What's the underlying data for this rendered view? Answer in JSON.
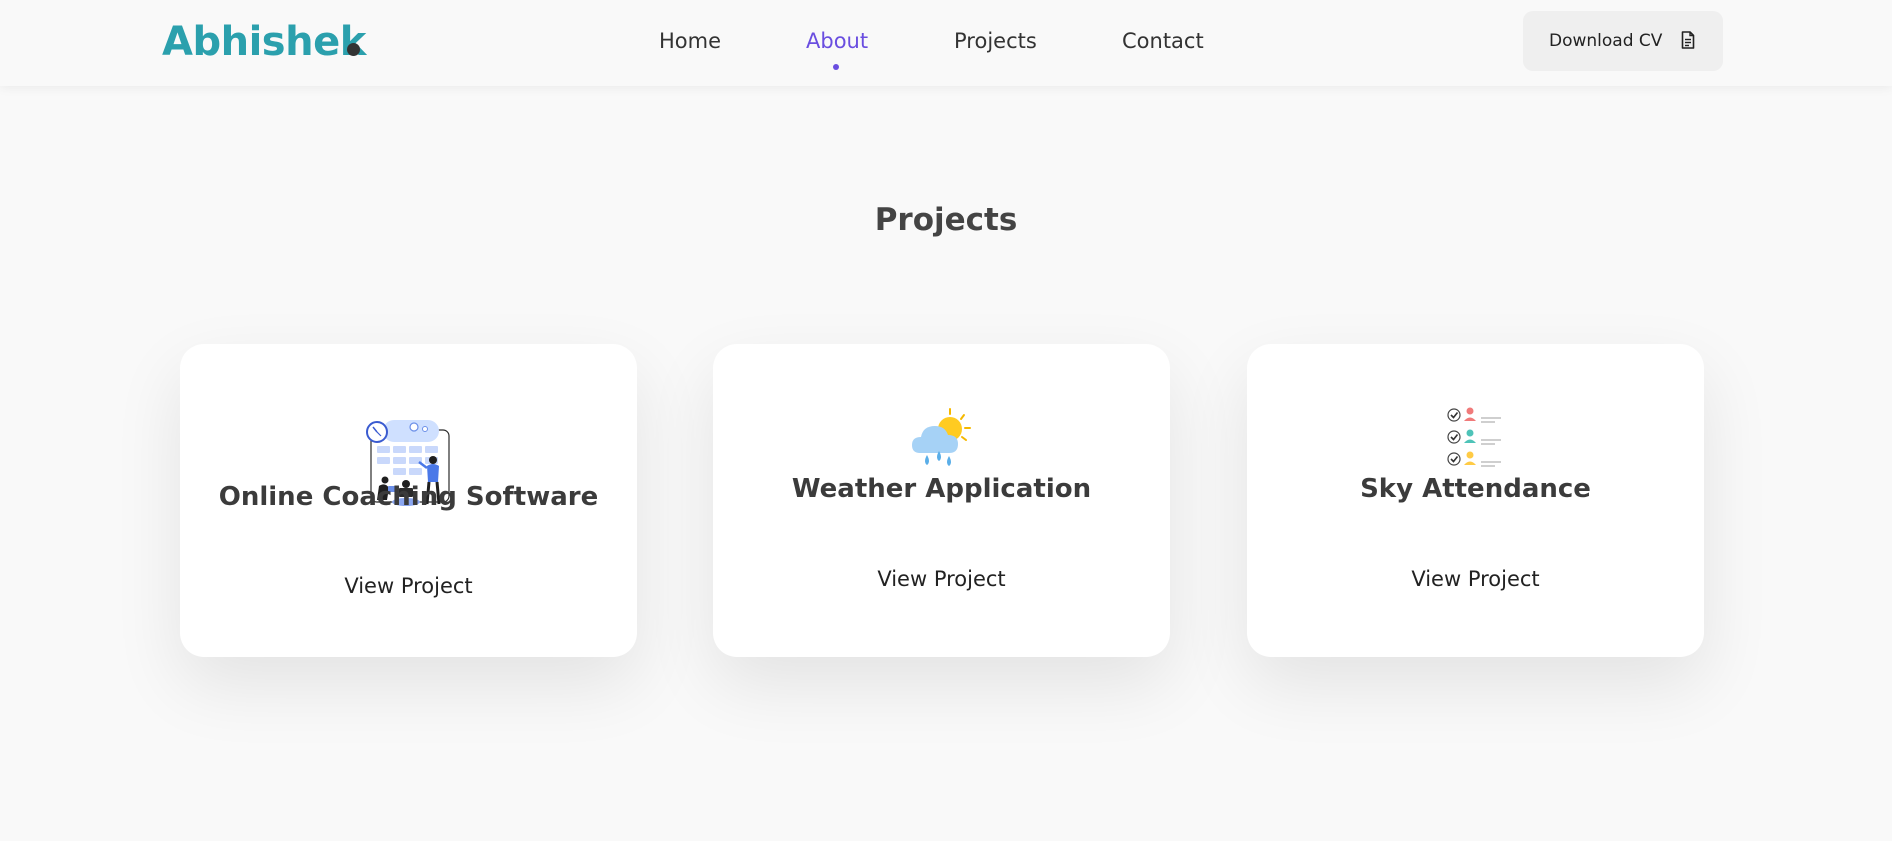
{
  "header": {
    "logo": "Abhishek",
    "nav": [
      {
        "label": "Home",
        "active": false
      },
      {
        "label": "About",
        "active": true
      },
      {
        "label": "Projects",
        "active": false
      },
      {
        "label": "Contact",
        "active": false
      }
    ],
    "cv_button": {
      "label": "Download CV",
      "icon": "document-icon"
    }
  },
  "projects": {
    "title": "Projects",
    "cards": [
      {
        "title": "Online Coaching Software",
        "link": "View Project",
        "icon": "coaching-illustration"
      },
      {
        "title": "Weather Application",
        "link": "View Project",
        "icon": "weather-cloud-sun-icon"
      },
      {
        "title": "Sky Attendance",
        "link": "View Project",
        "icon": "attendance-checklist-icon"
      }
    ]
  },
  "colors": {
    "brand": "#2ba0ad",
    "accent": "#6a4ee0",
    "background": "#f9f9f9",
    "text": "#333333"
  }
}
